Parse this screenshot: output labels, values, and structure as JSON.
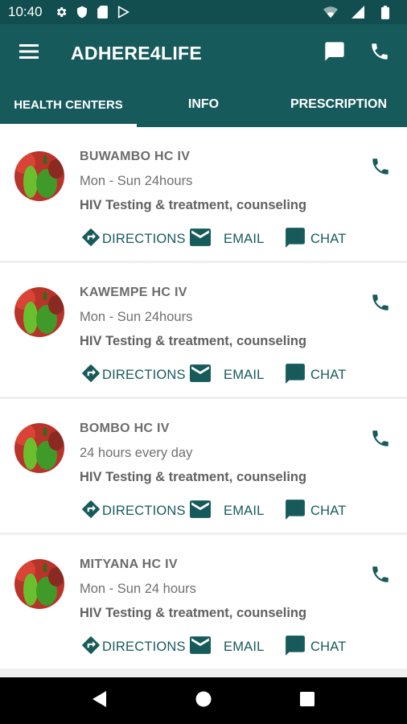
{
  "status_bar": {
    "time": "10:40",
    "icons": [
      "gear-icon",
      "shield-icon",
      "sd-card-icon",
      "play-store-icon",
      "wifi-icon",
      "signal-icon",
      "battery-icon"
    ]
  },
  "app_bar": {
    "title": "ADHERE4LIFE",
    "actions": [
      "message-icon",
      "phone-icon"
    ]
  },
  "tabs": [
    {
      "label": "HEALTH CENTERS",
      "active": true
    },
    {
      "label": "INFO",
      "active": false
    },
    {
      "label": "PRESCRIPTION",
      "active": false
    }
  ],
  "centers": [
    {
      "name": "BUWAMBO HC IV",
      "hours": "Mon - Sun 24hours",
      "services": "HIV Testing & treatment, counseling"
    },
    {
      "name": "KAWEMPE HC IV",
      "hours": "Mon - Sun 24hours",
      "services": "HIV Testing & treatment, counseling"
    },
    {
      "name": "BOMBO HC IV",
      "hours": "24 hours every day",
      "services": "HIV Testing & treatment, counseling"
    },
    {
      "name": "MITYANA HC IV",
      "hours": "Mon - Sun 24 hours",
      "services": "HIV Testing & treatment, counseling"
    }
  ],
  "card_actions": {
    "directions": "DIRECTIONS",
    "email": "EMAIL",
    "chat": "CHAT"
  },
  "colors": {
    "primary": "#175a5b",
    "status_bar": "#124e4f"
  }
}
